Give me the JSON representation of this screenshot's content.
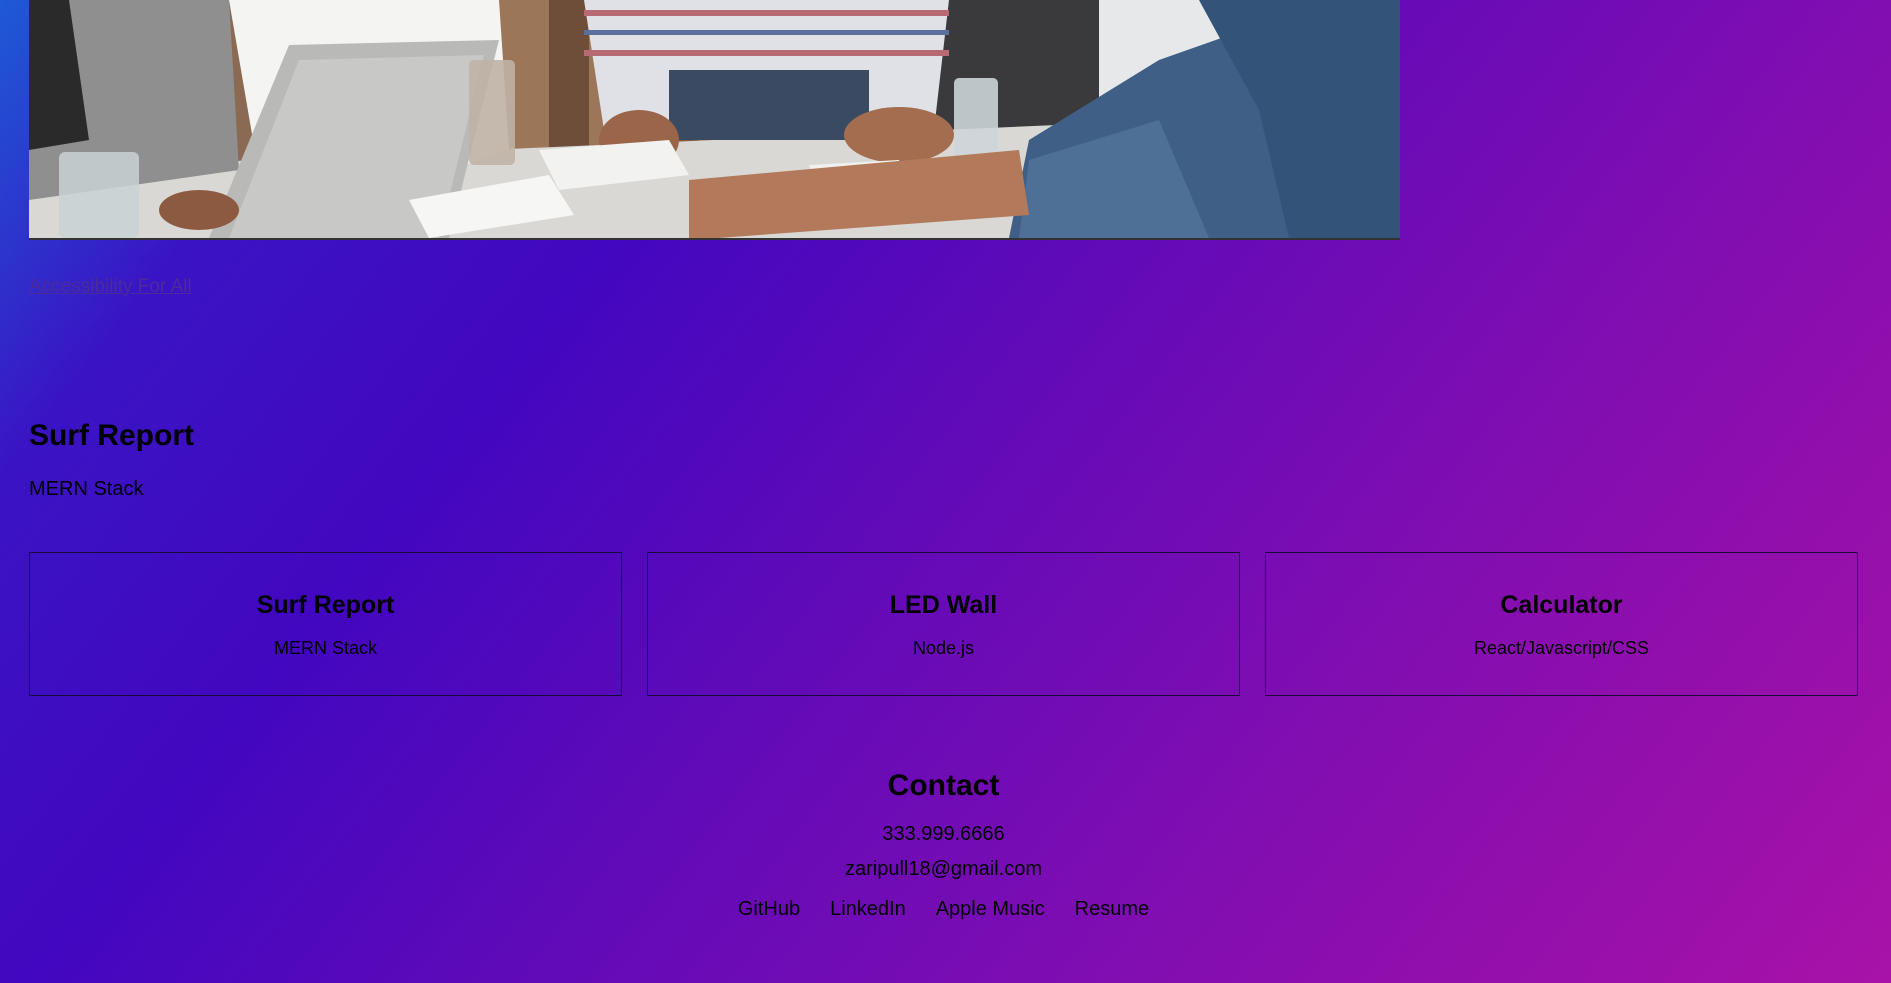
{
  "featured_link": "Accessibility For All",
  "feature": {
    "title": "Surf Report",
    "subtitle": "MERN Stack"
  },
  "projects": [
    {
      "title": "Surf Report",
      "tech": "MERN Stack"
    },
    {
      "title": "LED Wall",
      "tech": "Node.js"
    },
    {
      "title": "Calculator",
      "tech": "React/Javascript/CSS"
    }
  ],
  "contact": {
    "heading": "Contact",
    "phone": "333.999.6666",
    "email": "zaripull18@gmail.com",
    "links": [
      "GitHub",
      "LinkedIn",
      "Apple Music",
      "Resume"
    ]
  }
}
